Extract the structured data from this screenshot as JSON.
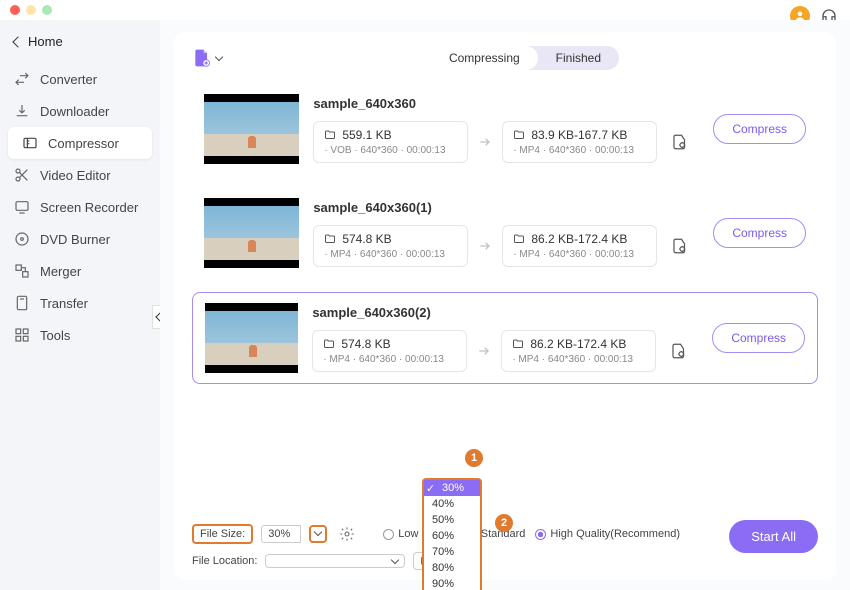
{
  "titlebar": {
    "back_label": "Home"
  },
  "header": {
    "avatar_initial": ""
  },
  "sidebar": {
    "items": [
      {
        "label": "Converter"
      },
      {
        "label": "Downloader"
      },
      {
        "label": "Compressor"
      },
      {
        "label": "Video Editor"
      },
      {
        "label": "Screen Recorder"
      },
      {
        "label": "DVD Burner"
      },
      {
        "label": "Merger"
      },
      {
        "label": "Transfer"
      },
      {
        "label": "Tools"
      }
    ],
    "active_index": 2
  },
  "tabs": {
    "compressing": "Compressing",
    "finished": "Finished"
  },
  "files": [
    {
      "name": "sample_640x360",
      "src": {
        "size": "559.1 KB",
        "meta": "· VOB  · 640*360  · 00:00:13"
      },
      "dst": {
        "size": "83.9 KB-167.7 KB",
        "meta": "· MP4  · 640*360  · 00:00:13"
      },
      "btn": "Compress"
    },
    {
      "name": "sample_640x360(1)",
      "src": {
        "size": "574.8 KB",
        "meta": "· MP4  · 640*360  · 00:00:13"
      },
      "dst": {
        "size": "86.2 KB-172.4 KB",
        "meta": "· MP4  · 640*360  · 00:00:13"
      },
      "btn": "Compress"
    },
    {
      "name": "sample_640x360(2)",
      "src": {
        "size": "574.8 KB",
        "meta": "· MP4  · 640*360  · 00:00:13"
      },
      "dst": {
        "size": "86.2 KB-172.4 KB",
        "meta": "· MP4  · 640*360  · 00:00:13"
      },
      "btn": "Compress"
    }
  ],
  "bottom": {
    "file_size_label": "File Size:",
    "file_size_value": "30%",
    "quality": {
      "low": "Low Quality",
      "standard": "Standard",
      "high": "High Quality(Recommend)"
    },
    "file_location_label": "File Location:",
    "start_all": "Start All"
  },
  "dropdown": {
    "options": [
      "30%",
      "40%",
      "50%",
      "60%",
      "70%",
      "80%",
      "90%"
    ],
    "selected": "30%"
  },
  "callouts": {
    "c1": "1",
    "c2": "2"
  }
}
